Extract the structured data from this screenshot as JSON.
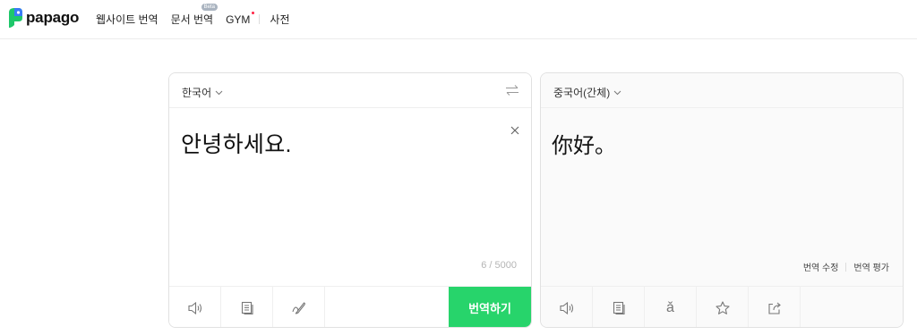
{
  "header": {
    "logo_text": "papago",
    "nav": {
      "website_translate": "웹사이트 번역",
      "document_translate": "문서 번역",
      "document_badge": "Beta",
      "gym": "GYM",
      "dictionary": "사전"
    }
  },
  "source": {
    "language": "한국어",
    "text": "안녕하세요.",
    "char_count": "6 / 5000",
    "translate_button": "번역하기"
  },
  "target": {
    "language": "중국어(간체)",
    "text": "你好。",
    "pinyin_icon_glyph": "ǎ",
    "edit_translation": "번역 수정",
    "rate_translation": "번역 평가"
  },
  "icons": {
    "logo": "papago-logo-icon",
    "swap": "swap-languages-icon",
    "clear": "close-icon",
    "speaker": "speaker-icon",
    "copy": "copy-icon",
    "handwriting": "handwriting-icon",
    "pinyin": "pinyin-icon",
    "favorite": "star-icon",
    "share": "share-icon"
  },
  "colors": {
    "brand_green": "#27d46b",
    "logo_blue": "#3a7bf6"
  }
}
